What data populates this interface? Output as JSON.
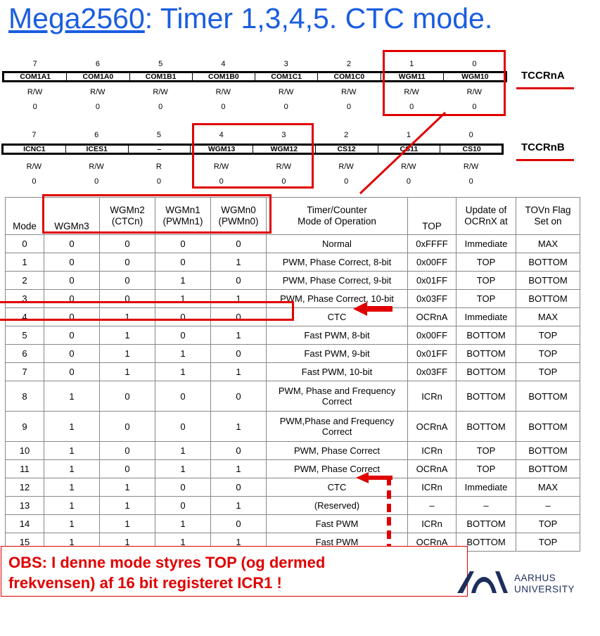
{
  "title": {
    "link": "Mega2560",
    "rest": ": Timer 1,3,4,5. CTC mode."
  },
  "tccrna": {
    "label": "TCCRnA",
    "bits": [
      "7",
      "6",
      "5",
      "4",
      "3",
      "2",
      "1",
      "0"
    ],
    "names": [
      "COM1A1",
      "COM1A0",
      "COM1B1",
      "COM1B0",
      "COM1C1",
      "COM1C0",
      "WGM11",
      "WGM10"
    ],
    "rw": [
      "R/W",
      "R/W",
      "R/W",
      "R/W",
      "R/W",
      "R/W",
      "R/W",
      "R/W"
    ],
    "init": [
      "0",
      "0",
      "0",
      "0",
      "0",
      "0",
      "0",
      "0"
    ]
  },
  "tccrnb": {
    "label": "TCCRnB",
    "bits": [
      "7",
      "6",
      "5",
      "4",
      "3",
      "2",
      "1",
      "0"
    ],
    "names": [
      "ICNC1",
      "ICES1",
      "–",
      "WGM13",
      "WGM12",
      "CS12",
      "CS11",
      "CS10"
    ],
    "rw": [
      "R/W",
      "R/W",
      "R",
      "R/W",
      "R/W",
      "R/W",
      "R/W",
      "R/W"
    ],
    "init": [
      "0",
      "0",
      "0",
      "0",
      "0",
      "0",
      "0",
      "0"
    ]
  },
  "table": {
    "headers": [
      "Mode",
      "WGMn3",
      "WGMn2\n(CTCn)",
      "WGMn1\n(PWMn1)",
      "WGMn0\n(PWMn0)",
      "Timer/Counter\nMode of Operation",
      "TOP",
      "Update of\nOCRnX at",
      "TOVn Flag\nSet on"
    ],
    "rows": [
      [
        "0",
        "0",
        "0",
        "0",
        "0",
        "Normal",
        "0xFFFF",
        "Immediate",
        "MAX"
      ],
      [
        "1",
        "0",
        "0",
        "0",
        "1",
        "PWM, Phase Correct, 8-bit",
        "0x00FF",
        "TOP",
        "BOTTOM"
      ],
      [
        "2",
        "0",
        "0",
        "1",
        "0",
        "PWM, Phase Correct, 9-bit",
        "0x01FF",
        "TOP",
        "BOTTOM"
      ],
      [
        "3",
        "0",
        "0",
        "1",
        "1",
        "PWM, Phase Correct, 10-bit",
        "0x03FF",
        "TOP",
        "BOTTOM"
      ],
      [
        "4",
        "0",
        "1",
        "0",
        "0",
        "CTC",
        "OCRnA",
        "Immediate",
        "MAX"
      ],
      [
        "5",
        "0",
        "1",
        "0",
        "1",
        "Fast PWM, 8-bit",
        "0x00FF",
        "BOTTOM",
        "TOP"
      ],
      [
        "6",
        "0",
        "1",
        "1",
        "0",
        "Fast PWM, 9-bit",
        "0x01FF",
        "BOTTOM",
        "TOP"
      ],
      [
        "7",
        "0",
        "1",
        "1",
        "1",
        "Fast PWM, 10-bit",
        "0x03FF",
        "BOTTOM",
        "TOP"
      ],
      [
        "8",
        "1",
        "0",
        "0",
        "0",
        "PWM, Phase and Frequency\nCorrect",
        "ICRn",
        "BOTTOM",
        "BOTTOM"
      ],
      [
        "9",
        "1",
        "0",
        "0",
        "1",
        "PWM,Phase and Frequency\nCorrect",
        "OCRnA",
        "BOTTOM",
        "BOTTOM"
      ],
      [
        "10",
        "1",
        "0",
        "1",
        "0",
        "PWM, Phase Correct",
        "ICRn",
        "TOP",
        "BOTTOM"
      ],
      [
        "11",
        "1",
        "0",
        "1",
        "1",
        "PWM, Phase Correct",
        "OCRnA",
        "TOP",
        "BOTTOM"
      ],
      [
        "12",
        "1",
        "1",
        "0",
        "0",
        "CTC",
        "ICRn",
        "Immediate",
        "MAX"
      ],
      [
        "13",
        "1",
        "1",
        "0",
        "1",
        "(Reserved)",
        "–",
        "–",
        "–"
      ],
      [
        "14",
        "1",
        "1",
        "1",
        "0",
        "Fast PWM",
        "ICRn",
        "BOTTOM",
        "TOP"
      ],
      [
        "15",
        "1",
        "1",
        "1",
        "1",
        "Fast PWM",
        "OCRnA",
        "BOTTOM",
        "TOP"
      ]
    ]
  },
  "note": {
    "line1": "OBS: I denne mode styres TOP (og dermed",
    "line2": "frekvensen) af 16 bit registeret ICR1 !"
  },
  "logo": {
    "line1": "AARHUS",
    "line2": "UNIVERSITY"
  },
  "colors": {
    "title": "#1a5de0",
    "highlight": "#e00000",
    "logo": "#1d2e5c"
  }
}
